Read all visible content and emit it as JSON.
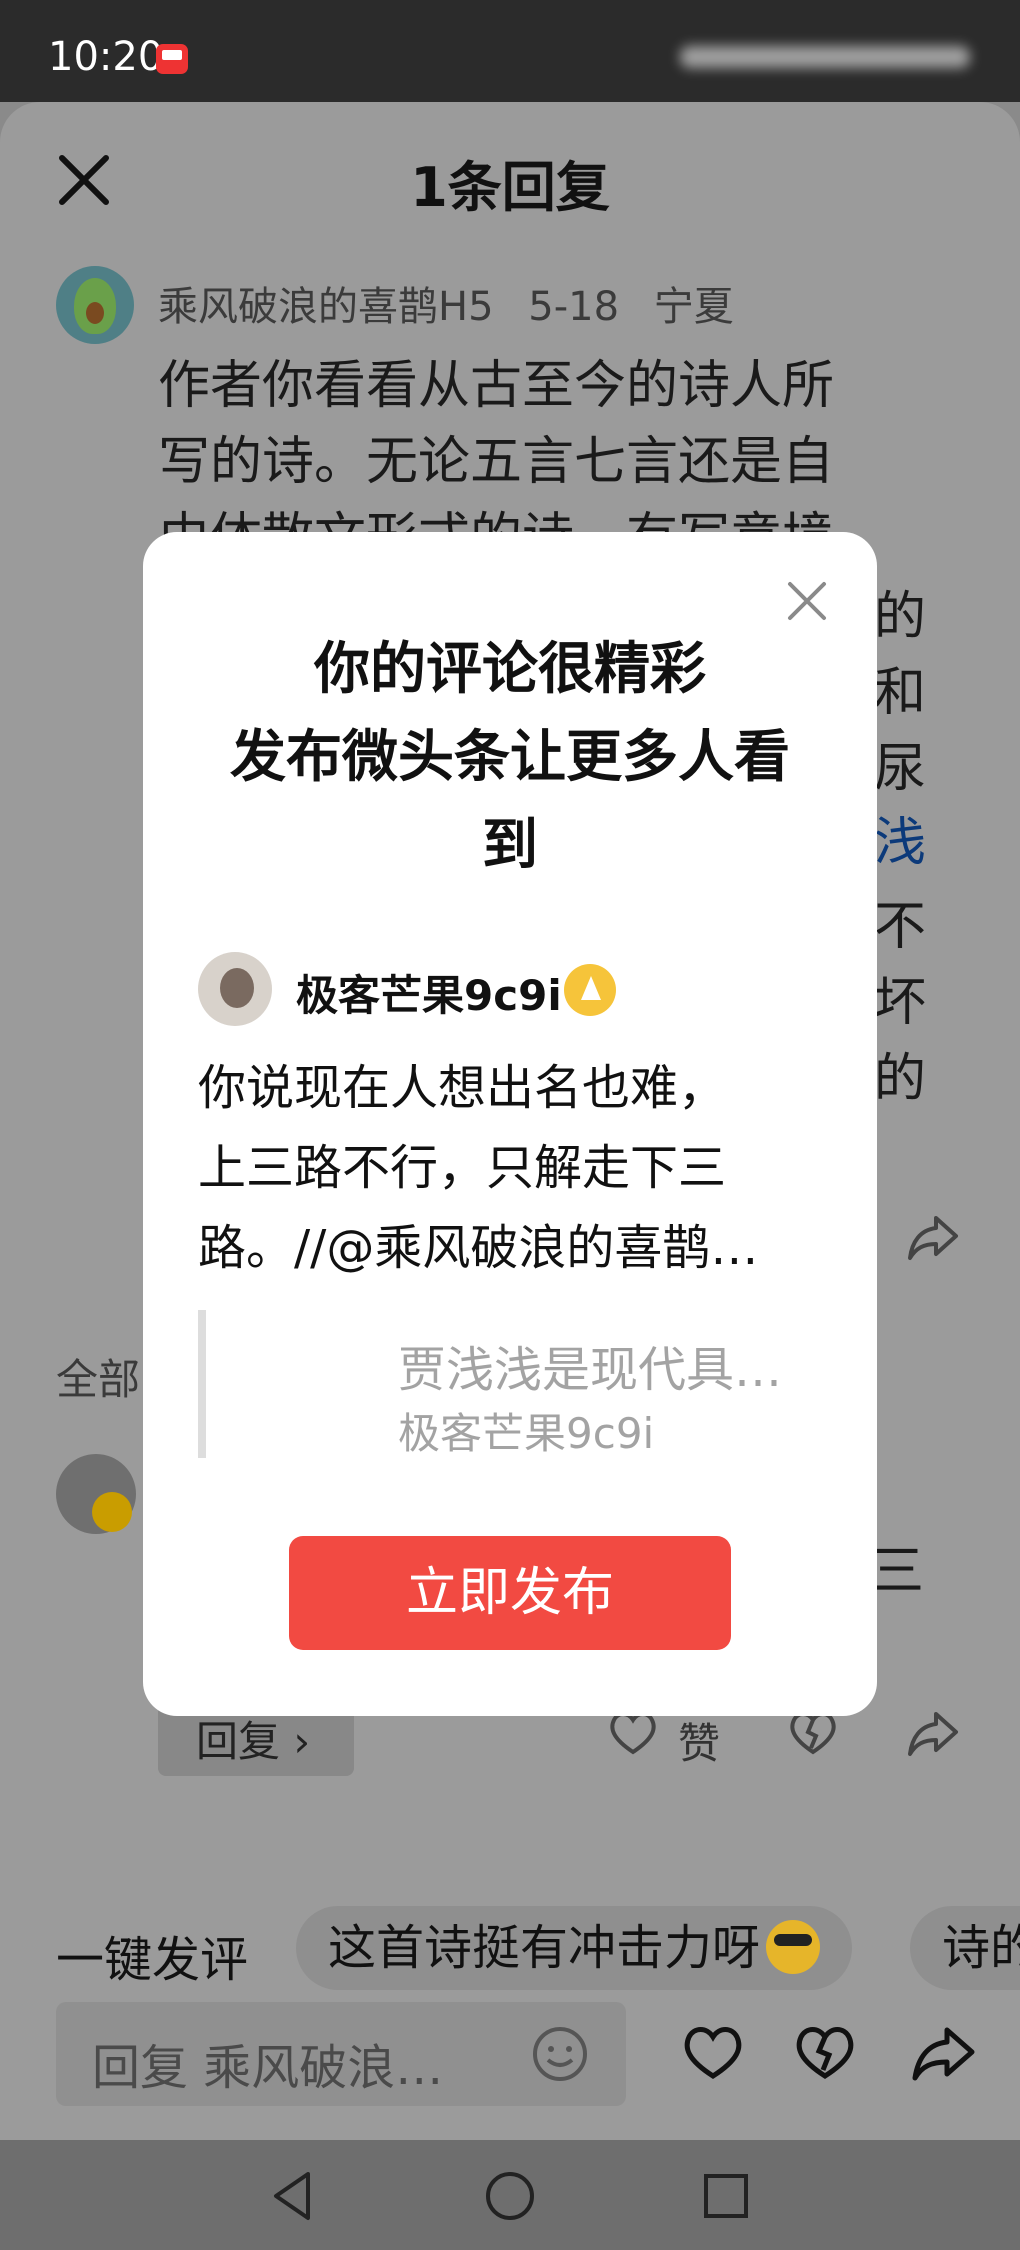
{
  "status_bar": {
    "time": "10:20"
  },
  "header": {
    "title": "1条回复"
  },
  "comment": {
    "username": "乘风破浪的喜鹊H5",
    "date": "5-18",
    "location": "宁夏",
    "lines": [
      "作者你看看从古至今的诗人所",
      "写的诗。无论五言七言还是自",
      "由体散文形式的诗，有写意境"
    ],
    "right_fragments": [
      "的",
      "和",
      "尿",
      "浅",
      "不",
      "坏",
      "的"
    ]
  },
  "all_replies_label": "全部",
  "reply": {
    "text_fragment": "三",
    "reply_button": "回复 ›",
    "like_label": "赞"
  },
  "quick_reply": {
    "label": "一键发评",
    "chips": [
      "这首诗挺有冲击力呀",
      "诗的"
    ]
  },
  "input": {
    "placeholder": "回复 乘风破浪…"
  },
  "modal": {
    "title_lines": [
      "你的评论很精彩",
      "发布微头条让更多人看",
      "到"
    ],
    "post_author": "极客芒果9c9i",
    "post_lines": [
      "你说现在人想出名也难，",
      "上三路不行，只解走下三",
      "路。//@乘风破浪的喜鹊…"
    ],
    "quote_text": "贾浅浅是现代具…",
    "quote_author": "极客芒果9c9i",
    "publish_button": "立即发布"
  },
  "icons": {
    "close": "close-icon",
    "share": "share-icon",
    "heart": "heart-icon",
    "broken_heart": "broken-heart-icon",
    "smile": "smile-icon",
    "back": "back-triangle-icon",
    "home": "home-circle-icon",
    "recents": "recents-square-icon"
  }
}
